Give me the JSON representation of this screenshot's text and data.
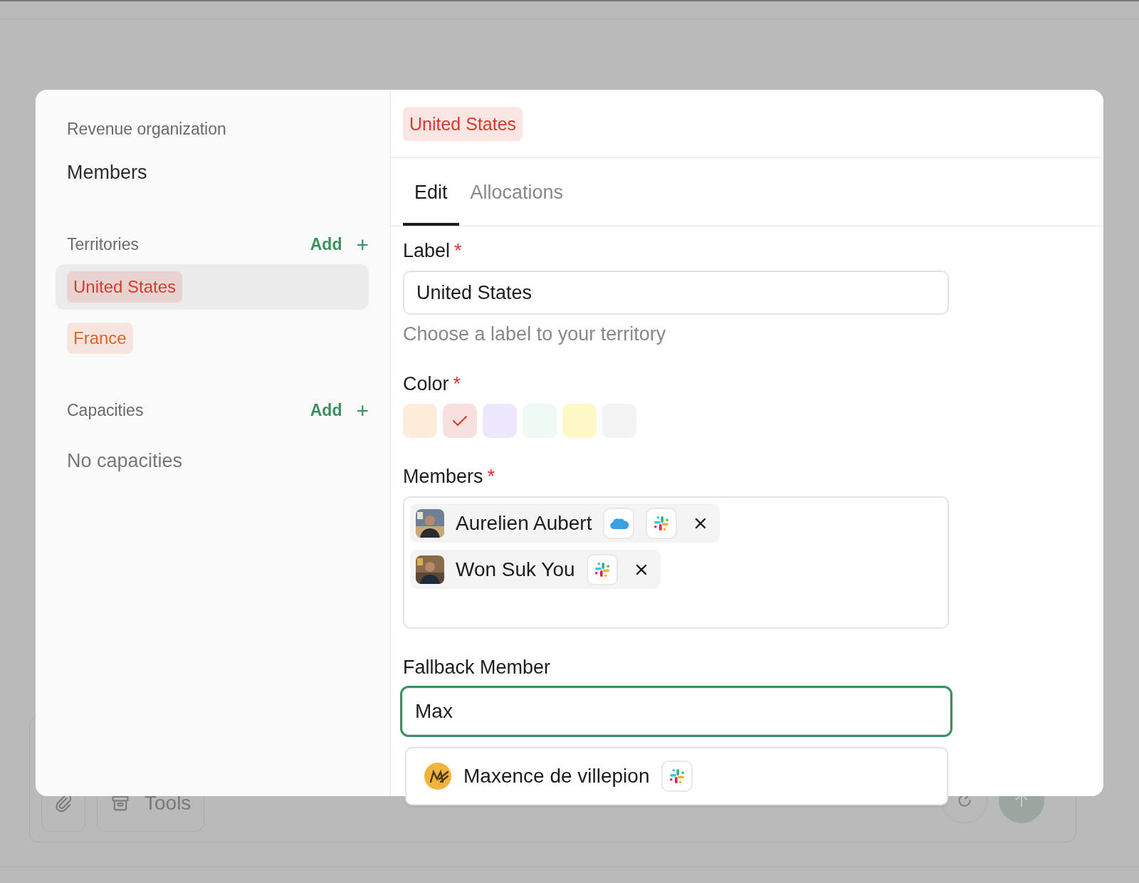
{
  "composer": {
    "tools": "Tools"
  },
  "sidebar": {
    "org": "Revenue organization",
    "title": "Members",
    "sections": [
      {
        "title": "Territories",
        "add": "Add",
        "add_icon": "+",
        "items": [
          {
            "label": "United States",
            "color": "#d63a2f",
            "selected": true
          },
          {
            "label": "France",
            "color": "#e0622a",
            "selected": false
          }
        ]
      },
      {
        "title": "Capacities",
        "add": "Add",
        "add_icon": "+",
        "empty": "No capacities"
      }
    ]
  },
  "header_chip": {
    "label": "United States",
    "color": "#d63a2f"
  },
  "tabs": [
    {
      "label": "Edit",
      "selected": true
    },
    {
      "label": "Allocations",
      "selected": false
    }
  ],
  "form": {
    "label_field": {
      "label": "Label",
      "required_mark": "*",
      "value": "United States",
      "hint": "Choose a label to your territory"
    },
    "color_field": {
      "label": "Color",
      "required_mark": "*",
      "swatches": [
        {
          "color": "#fcecd9",
          "selected": false
        },
        {
          "color": "#f8e0df",
          "selected": true
        },
        {
          "color": "#eee6fb",
          "selected": false
        },
        {
          "color": "#eefaf2",
          "selected": false
        },
        {
          "color": "#fdf8c6",
          "selected": false
        },
        {
          "color": "#f3f3f3",
          "selected": false
        }
      ]
    },
    "members_field": {
      "label": "Members",
      "required_mark": "*",
      "members": [
        {
          "name": "Aurelien Aubert",
          "apps": [
            {
              "kind": "cloud"
            },
            {
              "kind": "slack"
            }
          ]
        },
        {
          "name": "Won Suk You",
          "apps": [
            {
              "kind": "slack"
            }
          ]
        }
      ]
    },
    "fallback_field": {
      "label": "Fallback Member",
      "value": "Max",
      "focused": true,
      "suggestions": [
        {
          "name": "Maxence de villepion",
          "apps": [
            {
              "kind": "slack"
            }
          ]
        }
      ]
    }
  }
}
